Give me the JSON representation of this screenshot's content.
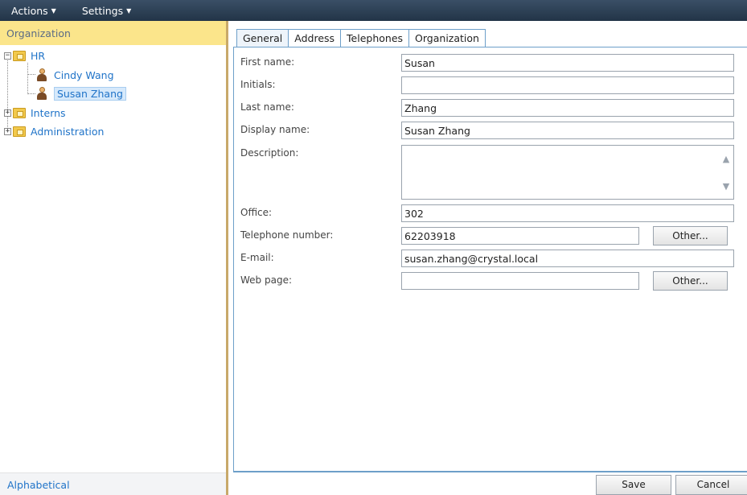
{
  "menubar": {
    "actions_label": "Actions",
    "settings_label": "Settings"
  },
  "left": {
    "header": "Organization",
    "footer": "Alphabetical",
    "tree": {
      "hr": "HR",
      "cindy": "Cindy Wang",
      "susan": "Susan Zhang",
      "interns": "Interns",
      "administration": "Administration"
    }
  },
  "tabs": [
    "General",
    "Address",
    "Telephones",
    "Organization"
  ],
  "form": {
    "first_name_label": "First name:",
    "first_name_value": "Susan",
    "initials_label": "Initials:",
    "initials_value": "",
    "last_name_label": "Last name:",
    "last_name_value": "Zhang",
    "display_name_label": "Display name:",
    "display_name_value": "Susan Zhang",
    "description_label": "Description:",
    "description_value": "",
    "office_label": "Office:",
    "office_value": "302",
    "telephone_label": "Telephone number:",
    "telephone_value": "62203918",
    "email_label": "E-mail:",
    "email_value": "susan.zhang@crystal.local",
    "web_label": "Web page:",
    "web_value": "",
    "other_label": "Other..."
  },
  "buttons": {
    "save": "Save",
    "cancel": "Cancel"
  }
}
